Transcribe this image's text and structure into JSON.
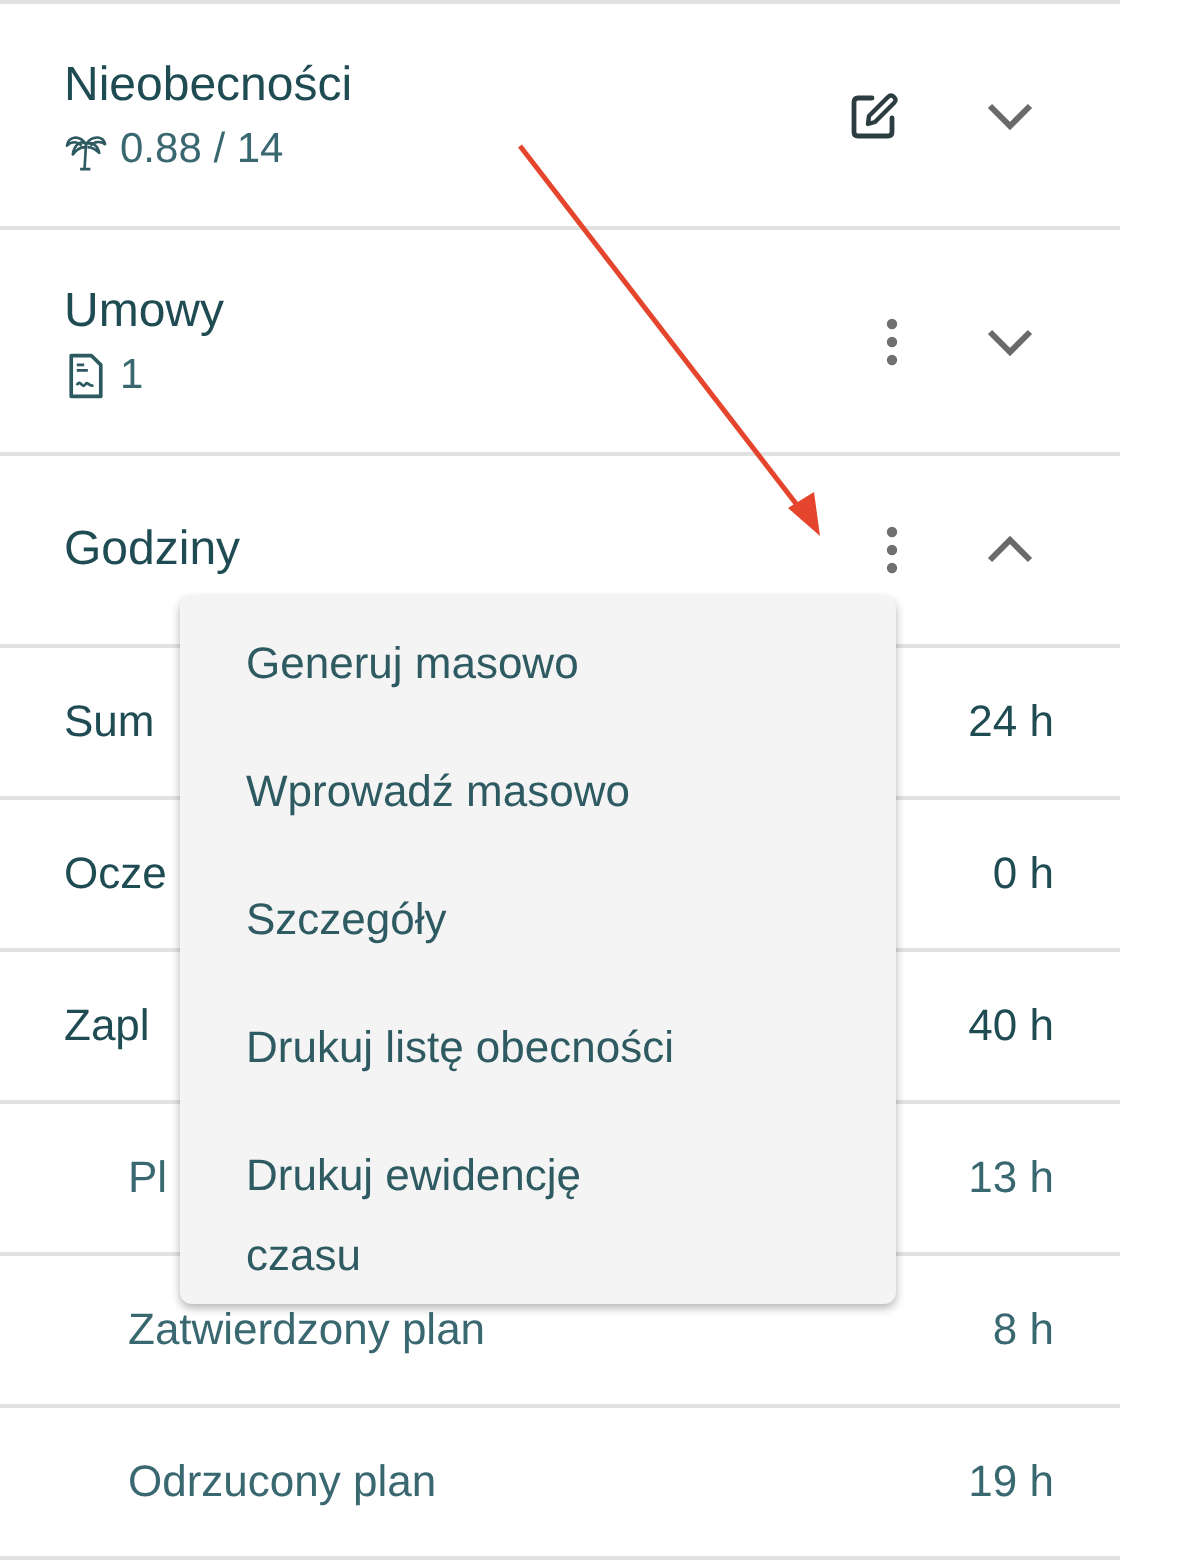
{
  "sections": [
    {
      "title": "Nieobecności",
      "subtitle": {
        "kind": "palm",
        "text": "0.88 / 14"
      },
      "kind": "edit",
      "expanded": false
    },
    {
      "title": "Umowy",
      "subtitle": {
        "kind": "document",
        "text": "1"
      },
      "kind": "more",
      "expanded": false
    },
    {
      "title": "Godziny",
      "kind": "more",
      "expanded": true,
      "rows": [
        {
          "label": "Sum",
          "value": "24 h"
        },
        {
          "label": "Ocze",
          "value": "0 h"
        },
        {
          "label": "Zapl",
          "value": "40 h",
          "children": [
            {
              "label": "Pl",
              "value": "13 h"
            },
            {
              "label": "Zatwierdzony plan",
              "value": "8 h"
            },
            {
              "label": "Odrzucony plan",
              "value": "19 h"
            }
          ]
        }
      ],
      "menu": [
        {
          "lines": [
            "Generuj masowo"
          ]
        },
        {
          "lines": [
            "Wprowadź masowo"
          ]
        },
        {
          "lines": [
            "Szczegóły"
          ]
        },
        {
          "lines": [
            "Drukuj listę obecności"
          ]
        },
        {
          "lines": [
            "Drukuj ewidencję",
            "czasu"
          ]
        }
      ]
    }
  ]
}
